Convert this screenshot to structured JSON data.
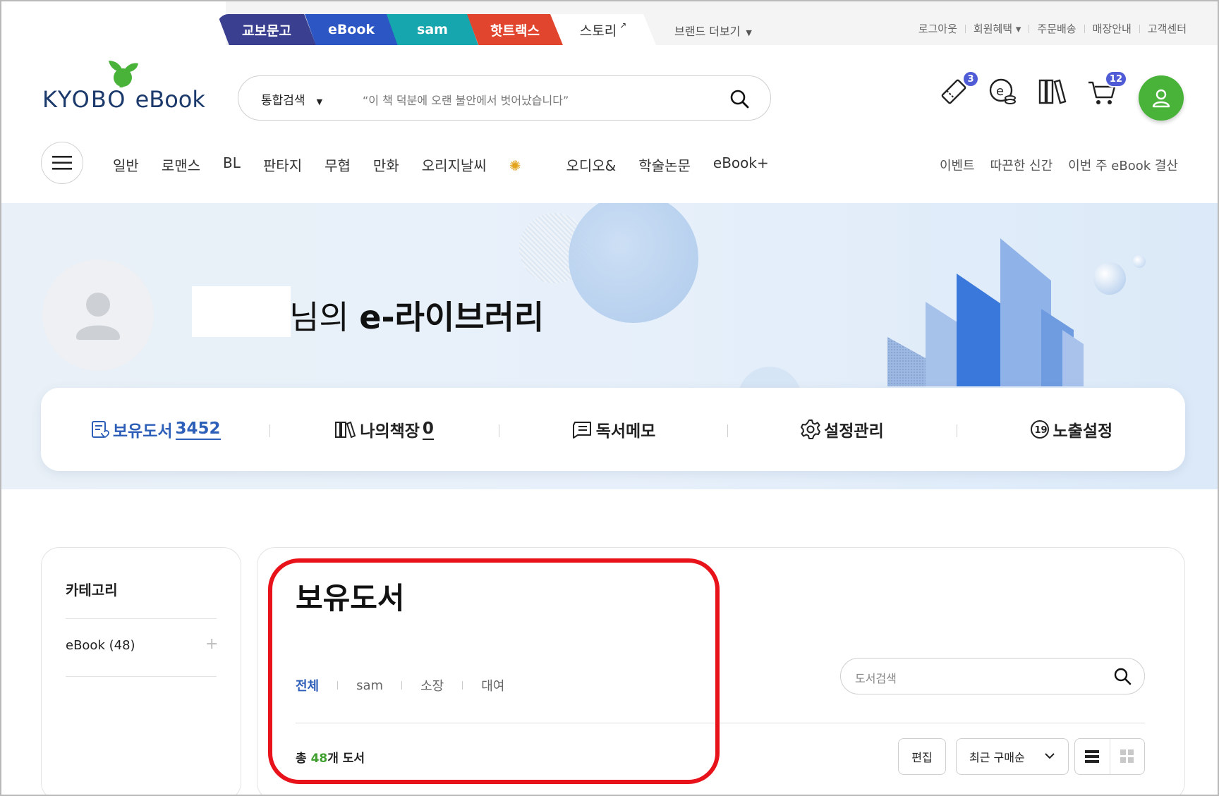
{
  "brand_tabs": [
    "교보문고",
    "eBook",
    "sam",
    "핫트랙스",
    "스토리"
  ],
  "more_brands": "브랜드 더보기",
  "util_links": [
    "로그아웃",
    "회원혜택 ▾",
    "주문배송",
    "매장안내",
    "고객센터"
  ],
  "logo": {
    "main": "KYOBO",
    "sub": "eBook"
  },
  "search": {
    "scope": "통합검색",
    "placeholder": "“이 책 덕분에 오랜 불안에서 벗어났습니다”"
  },
  "header_badges": {
    "coupon": "3",
    "cart": "12"
  },
  "gnb": [
    "일반",
    "로맨스",
    "BL",
    "판타지",
    "무협",
    "만화",
    "오리지날씨",
    "오디오&",
    "학술논문",
    "eBook+"
  ],
  "subnav": [
    "이벤트",
    "따끈한 신간",
    "이번 주 eBook 결산"
  ],
  "hero": {
    "title_suffix": "님의 ",
    "title_bold": "e-라이브러리"
  },
  "library_tabs": [
    {
      "label": "보유도서",
      "count": "3452"
    },
    {
      "label": "나의책장",
      "count": "0"
    },
    {
      "label": "독서메모"
    },
    {
      "label": "설정관리"
    },
    {
      "label": "노출설정"
    }
  ],
  "sidebar": {
    "title": "카테고리",
    "item": "eBook (48)"
  },
  "main": {
    "title": "보유도서",
    "filters": [
      "전체",
      "sam",
      "소장",
      "대여"
    ],
    "book_search_placeholder": "도서검색",
    "total_prefix": "총 ",
    "total_count": "48",
    "total_suffix": "개 도서",
    "edit_label": "편집",
    "sort_label": "최근 구매순"
  },
  "colors": {
    "accent_blue": "#2d5fb8",
    "brand_green": "#48b239",
    "badge": "#4f5cd6",
    "highlight": "#e8121b"
  }
}
